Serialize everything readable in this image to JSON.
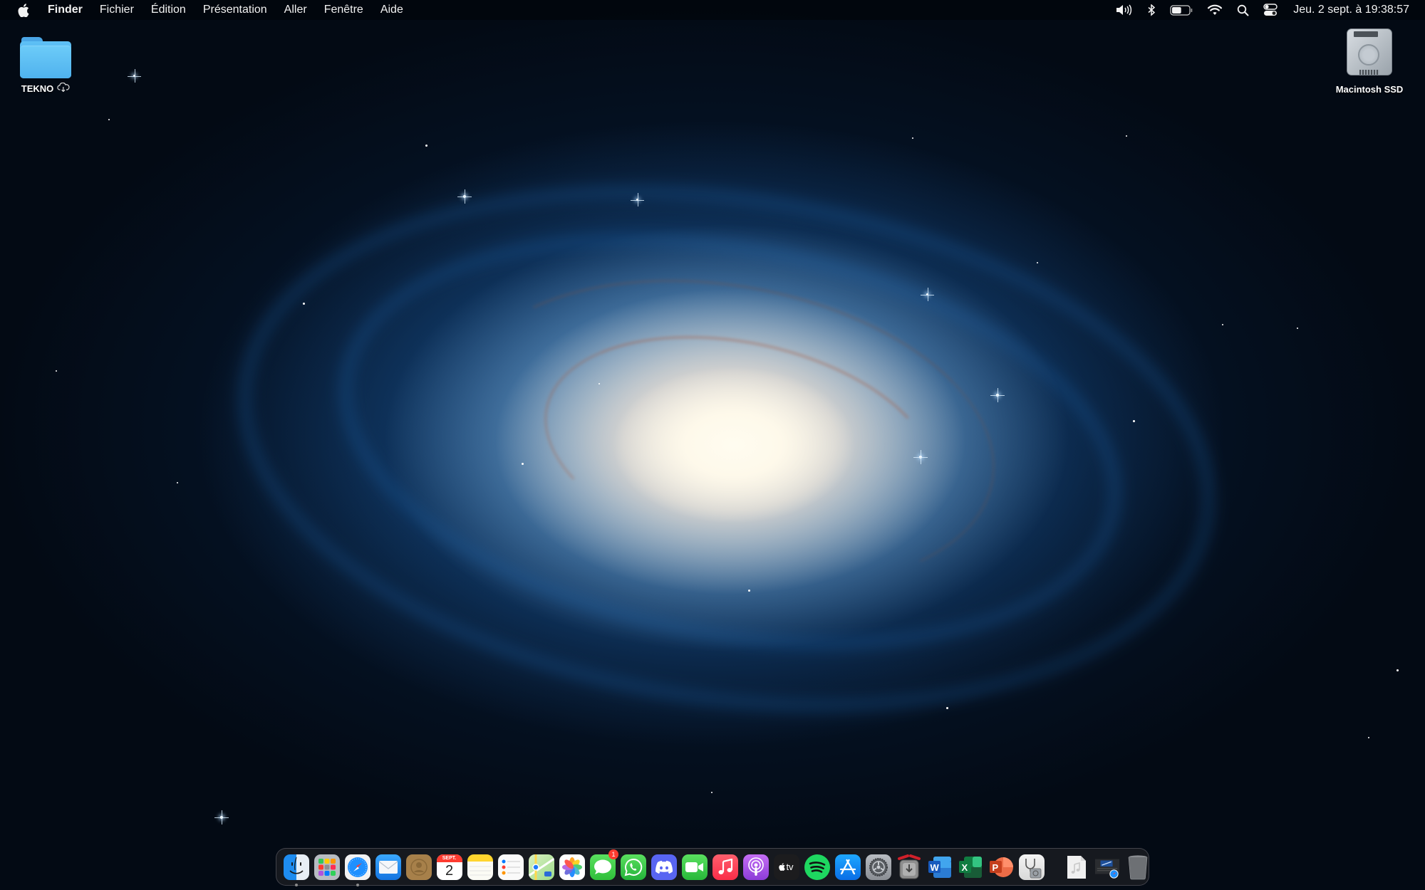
{
  "menubar": {
    "apple_icon": "apple-logo-icon",
    "app_name": "Finder",
    "menus": [
      "Fichier",
      "Édition",
      "Présentation",
      "Aller",
      "Fenêtre",
      "Aide"
    ],
    "status_icons": [
      "volume-icon",
      "bluetooth-icon",
      "battery-icon",
      "wifi-icon",
      "spotlight-search-icon",
      "control-center-icon"
    ],
    "battery_level": 0.55,
    "clock": "Jeu. 2 sept. à  19:38:57"
  },
  "desktop": {
    "icons": [
      {
        "label": "TEKNO",
        "type": "folder",
        "cloud_status": "icloud-download-icon"
      },
      {
        "label": "Macintosh SSD",
        "type": "hard-drive"
      }
    ]
  },
  "dock": {
    "apps": [
      {
        "name": "Finder",
        "running": true
      },
      {
        "name": "Launchpad",
        "running": false
      },
      {
        "name": "Safari",
        "running": true
      },
      {
        "name": "Mail",
        "running": false
      },
      {
        "name": "Contacts",
        "running": false
      },
      {
        "name": "Calendar",
        "running": false,
        "month": "SEPT.",
        "day": "2"
      },
      {
        "name": "Notes",
        "running": false
      },
      {
        "name": "Reminders",
        "running": false
      },
      {
        "name": "Maps",
        "running": false
      },
      {
        "name": "Photos",
        "running": false
      },
      {
        "name": "Messages",
        "running": false,
        "badge": "1"
      },
      {
        "name": "WhatsApp",
        "running": false
      },
      {
        "name": "Discord",
        "running": false
      },
      {
        "name": "FaceTime",
        "running": false
      },
      {
        "name": "Music",
        "running": false
      },
      {
        "name": "Podcasts",
        "running": false
      },
      {
        "name": "Apple TV",
        "running": false,
        "label": "tv"
      },
      {
        "name": "Spotify",
        "running": false
      },
      {
        "name": "App Store",
        "running": false
      },
      {
        "name": "System Preferences",
        "running": false
      },
      {
        "name": "Transmission",
        "running": false
      },
      {
        "name": "Microsoft Word",
        "running": false,
        "letter": "W"
      },
      {
        "name": "Microsoft Excel",
        "running": false,
        "letter": "X"
      },
      {
        "name": "Microsoft PowerPoint",
        "running": false,
        "letter": "P"
      },
      {
        "name": "Disk Utility",
        "running": false
      }
    ],
    "others": [
      {
        "name": "Audio File"
      },
      {
        "name": "Safari Window"
      },
      {
        "name": "Trash"
      }
    ]
  },
  "colors": {
    "menubar_text": "#f2f2f2",
    "folder_blue": "#5ec0f5",
    "badge_red": "#ff3b30"
  }
}
